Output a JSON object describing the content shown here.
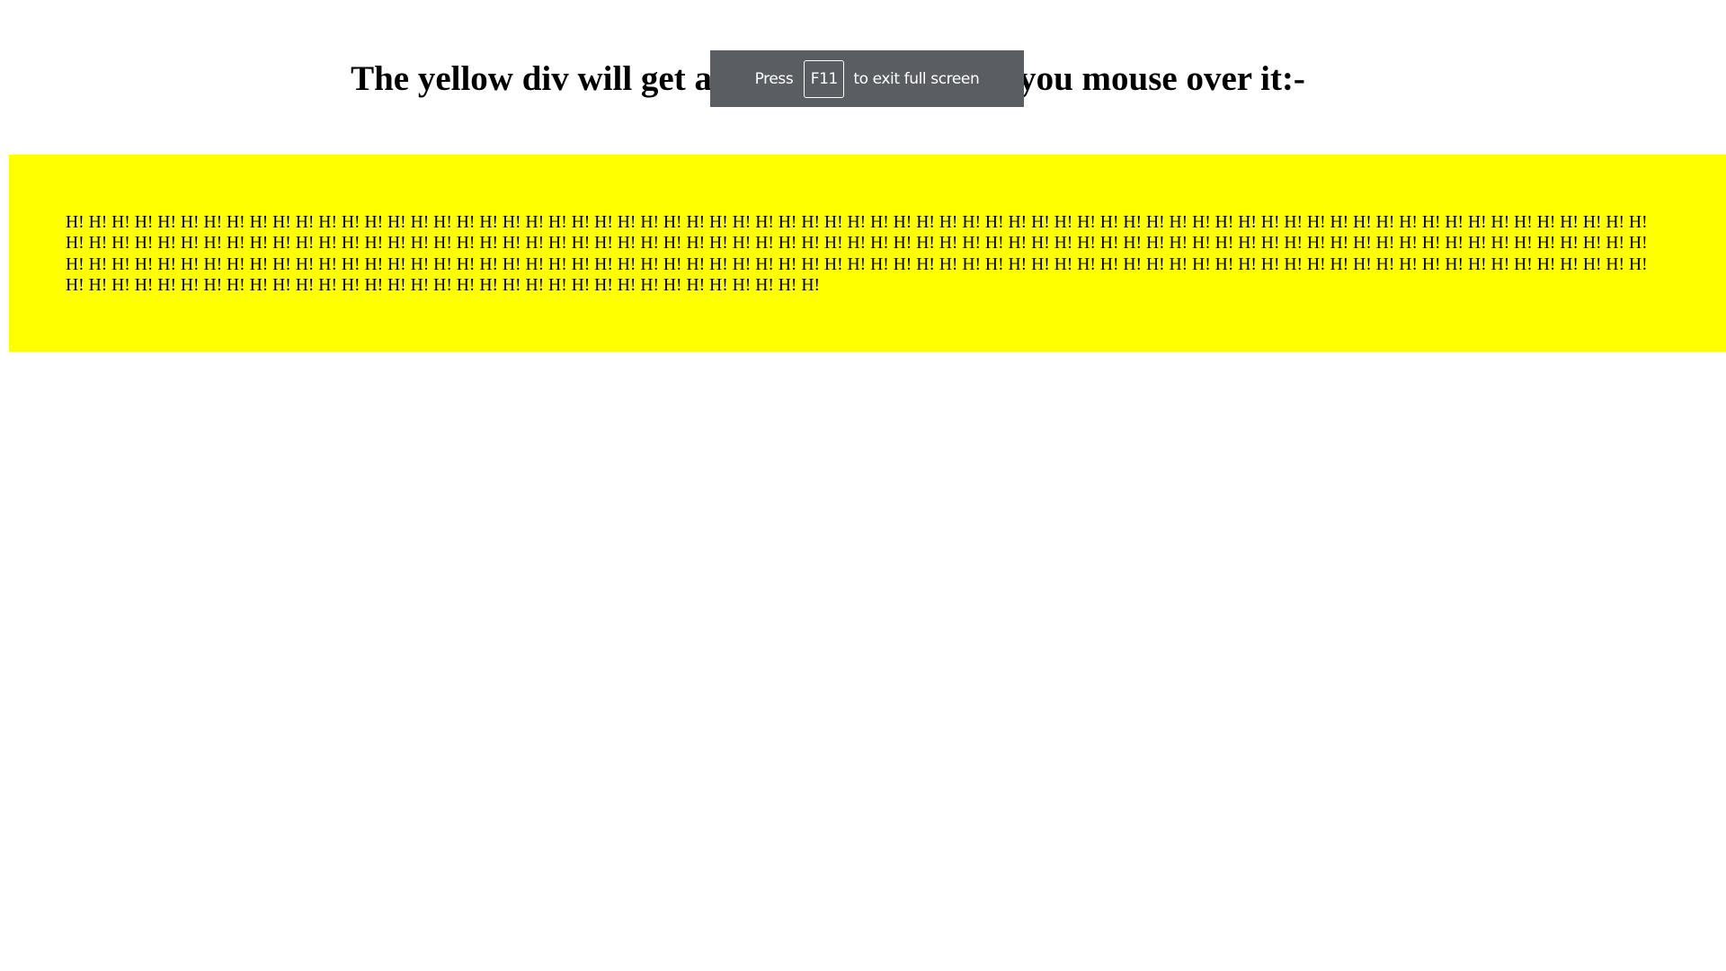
{
  "page": {
    "heading": "The yellow div will get a new line every time you mouse over it:-"
  },
  "hover_box": {
    "background_color": "#ffff00",
    "text": "H! H! H! H! H! H! H! H! H! H! H! H! H! H! H! H! H! H! H! H! H! H! H! H! H! H! H! H! H! H! H! H! H! H! H! H! H! H! H! H! H! H! H! H! H! H! H! H! H! H! H! H! H! H! H! H! H! H! H! H! H! H! H! H! H! H! H! H! H! H! H! H! H! H! H! H! H! H! H! H! H! H! H! H! H! H! H! H! H! H! H! H! H! H! H! H! H! H! H! H! H! H! H! H! H! H! H! H! H! H! H! H! H! H! H! H! H! H! H! H! H! H! H! H! H! H! H! H! H! H! H! H! H! H! H! H! H! H! H! H! H! H! H! H! H! H! H! H! H! H! H! H! H! H! H! H! H! H! H! H! H! H! H! H! H! H! H! H! H! H! H! H! H! H! H! H! H! H! H! H! H! H! H! H! H! H! H! H! H! H! H! H! H! H! H! H! H! H! H! H! H! H! H! H! H! H! H! H! H! H! H! H! H! H! H! H! H! H! H! H! H! H! H! H! H! H! H! H! H! H! H! H! H! H! H! H! H! H! H! H!"
  },
  "fullscreen_notice": {
    "prefix": "Press",
    "key": "F11",
    "suffix": "to exit full screen",
    "background_color": "#5a5d62"
  }
}
